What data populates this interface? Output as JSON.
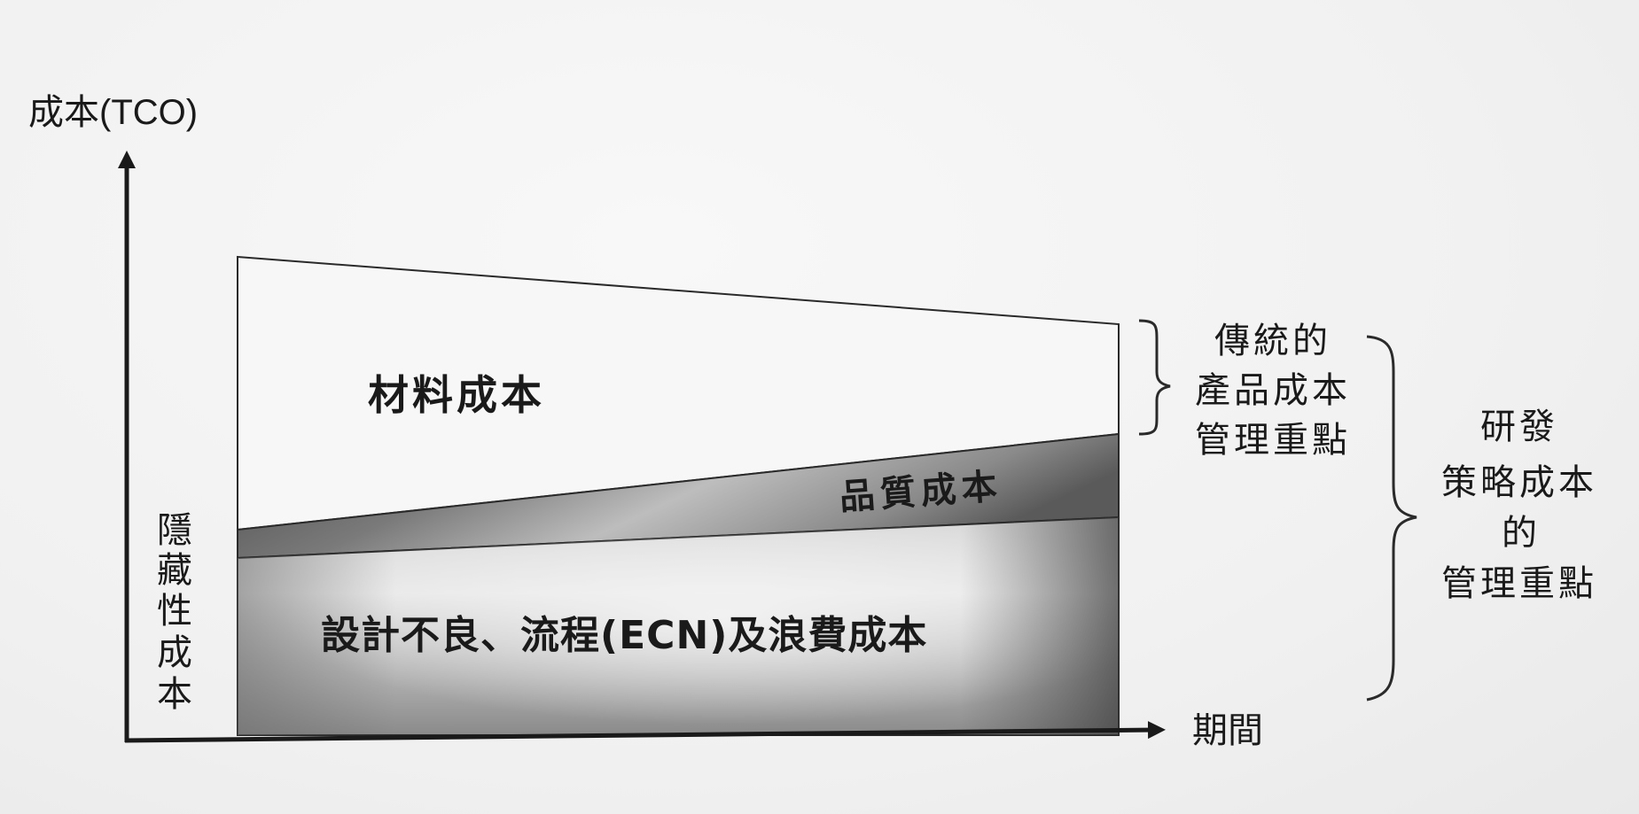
{
  "axes": {
    "y_label": "成本(TCO)",
    "x_label": "期間"
  },
  "regions": {
    "material": "材料成本",
    "quality": "品質成本",
    "design": "設計不良、流程(ECN)及浪費成本"
  },
  "hidden_label": [
    "隱",
    "藏",
    "性",
    "成",
    "本"
  ],
  "traditional_focus": [
    "傳統的",
    "產品成本",
    "管理重點"
  ],
  "rd_focus": [
    "研發",
    "策略成本",
    "的",
    "管理重點"
  ]
}
